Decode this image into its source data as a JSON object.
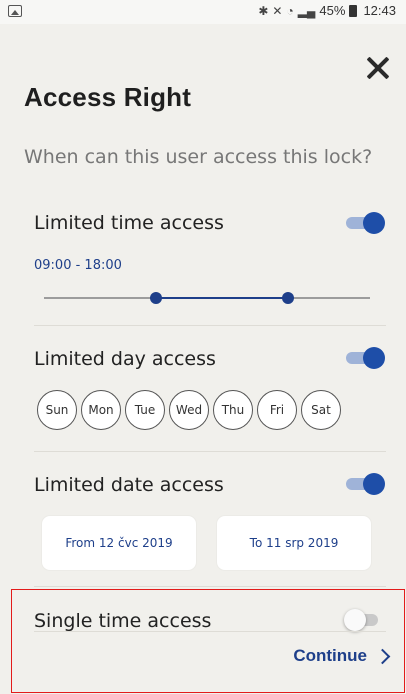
{
  "status_bar": {
    "battery": "45%",
    "time": "12:43"
  },
  "header": {
    "title": "Access Right",
    "subtitle": "When can this user access this lock?"
  },
  "limited_time": {
    "label": "Limited time access",
    "enabled": true,
    "range_text": "09:00 - 18:00"
  },
  "limited_day": {
    "label": "Limited day access",
    "enabled": true,
    "days": [
      "Sun",
      "Mon",
      "Tue",
      "Wed",
      "Thu",
      "Fri",
      "Sat"
    ]
  },
  "limited_date": {
    "label": "Limited date access",
    "enabled": true,
    "from_label": "From 12 čvc 2019",
    "to_label": "To 11 srp 2019"
  },
  "single_time": {
    "label": "Single time access",
    "enabled": false
  },
  "footer": {
    "continue_label": "Continue"
  },
  "colors": {
    "accent": "#1e3f8a",
    "toggle_on": "#1e4ea8",
    "background": "#f1f0ec",
    "highlight": "#e31b1b"
  }
}
